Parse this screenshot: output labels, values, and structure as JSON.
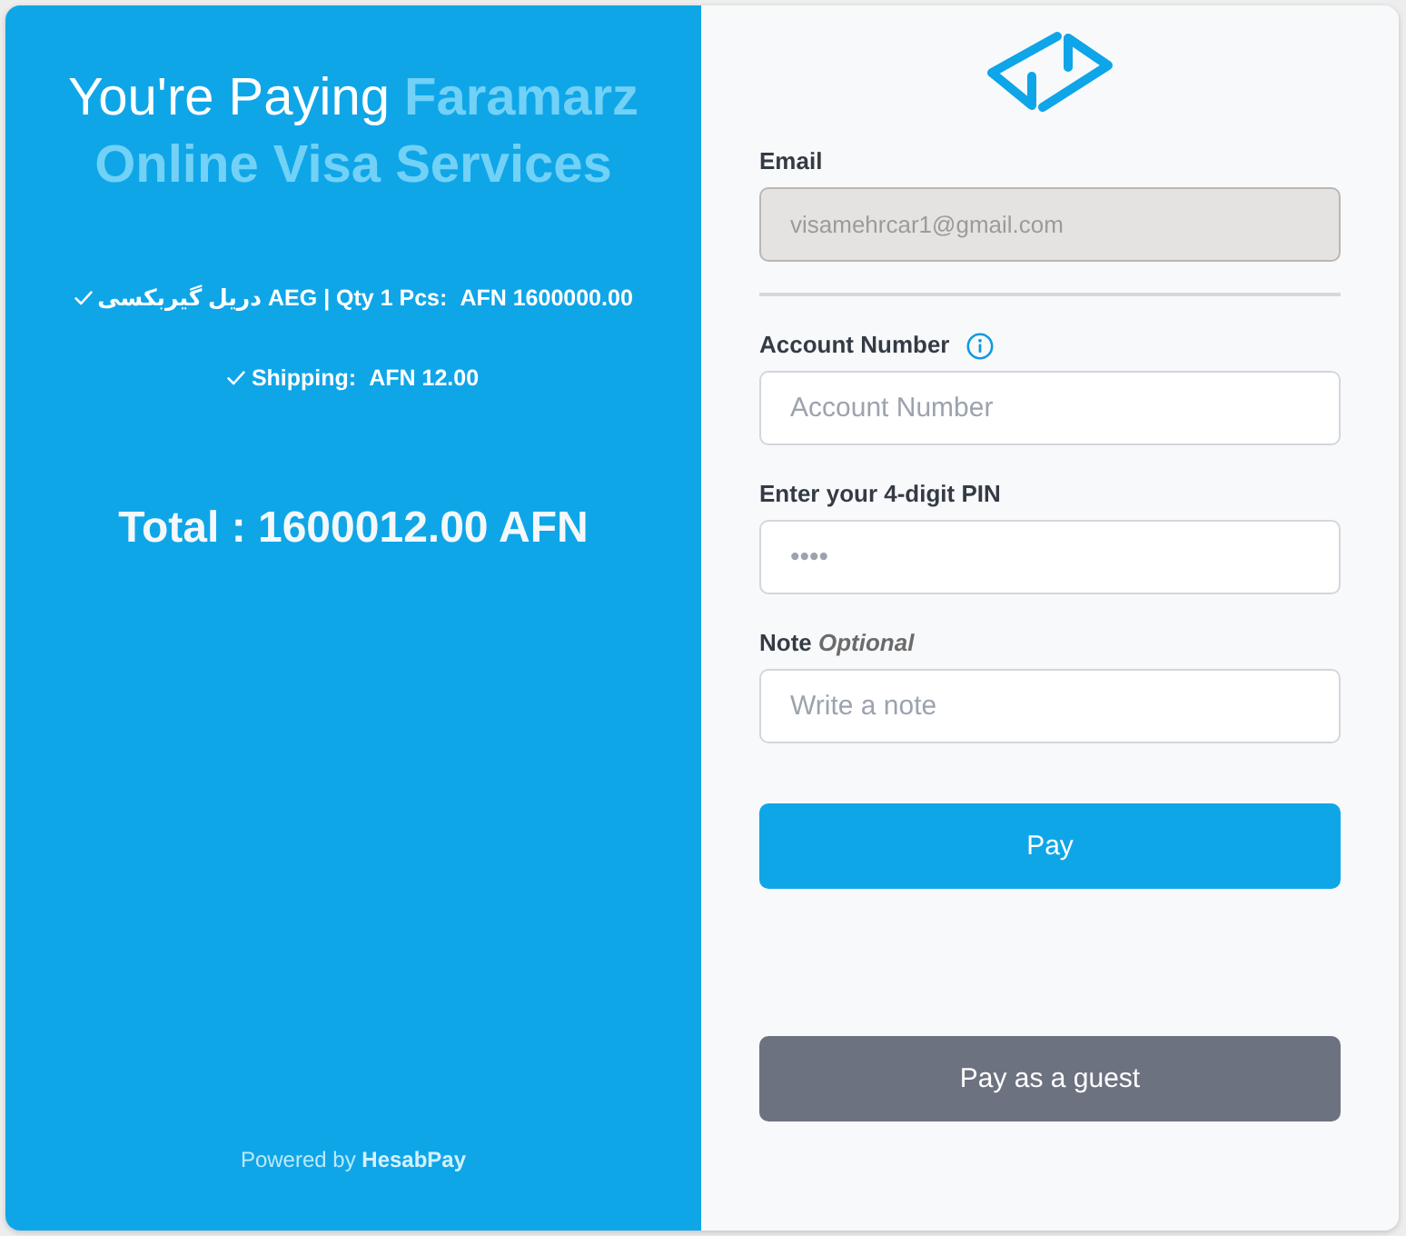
{
  "summary": {
    "heading": "You're Paying",
    "merchant": "Faramarz Online Visa Services",
    "items": [
      {
        "label": "دریل گیربکسی AEG | Qty 1 Pcs:",
        "amount": "AFN 1600000.00"
      },
      {
        "label": "Shipping:",
        "amount": "AFN 12.00"
      }
    ],
    "total": "Total : 1600012.00 AFN",
    "footer": "Powered by **HesabPay**"
  },
  "form": {
    "email": {
      "label": "Email",
      "value": "visamehrcar1@gmail.com",
      "disabled": true
    },
    "account_number": {
      "label": "Account Number",
      "placeholder": "Account Number",
      "disabled": false
    },
    "pin": {
      "label": "Enter your 4-digit PIN",
      "placeholder": "••••",
      "disabled": false
    },
    "note": {
      "label": "Note *Optional*",
      "placeholder": "Write a note",
      "disabled": false
    },
    "buttons": [
      {
        "kind": "primary",
        "label": "Pay"
      },
      {
        "kind": "secondary",
        "label": "Pay as a guest"
      }
    ]
  }
}
